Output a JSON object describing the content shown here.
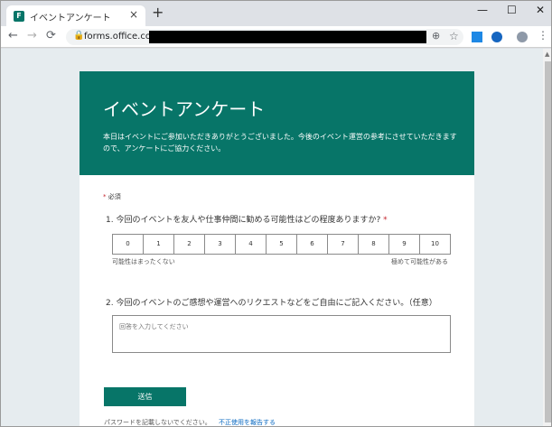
{
  "browser": {
    "tab_title": "イベントアンケート",
    "tab_close": "×",
    "new_tab": "+",
    "url": "forms.office.com/",
    "back": "←",
    "forward": "→",
    "reload": "⟳",
    "lock": "🔒",
    "zoom": "⊕",
    "star": "☆",
    "menu": "⋮",
    "minimize": "—",
    "maximize": "☐",
    "close": "✕"
  },
  "form": {
    "title": "イベントアンケート",
    "description": "本日はイベントにご参加いただきありがとうございました。今後のイベント運営の参考にさせていただきますので、アンケートにご協力ください。",
    "required_marker": "*",
    "required_label": "必須",
    "question1": {
      "text": "1. 今回のイベントを友人や仕事仲間に勧める可能性はどの程度ありますか?",
      "marker": "*",
      "scale": [
        "0",
        "1",
        "2",
        "3",
        "4",
        "5",
        "6",
        "7",
        "8",
        "9",
        "10"
      ],
      "low_label": "可能性はまったくない",
      "high_label": "極めて可能性がある"
    },
    "question2": {
      "text": "2. 今回のイベントのご感想や運営へのリクエストなどをご自由にご記入ください。（任意）",
      "placeholder": "回答を入力してください"
    },
    "submit_label": "送信",
    "footer_text": "パスワードを記載しないでください。",
    "footer_link": "不正使用を報告する"
  },
  "colors": {
    "brand": "#077568",
    "required": "#c4262e",
    "link": "#0a6ac2"
  }
}
